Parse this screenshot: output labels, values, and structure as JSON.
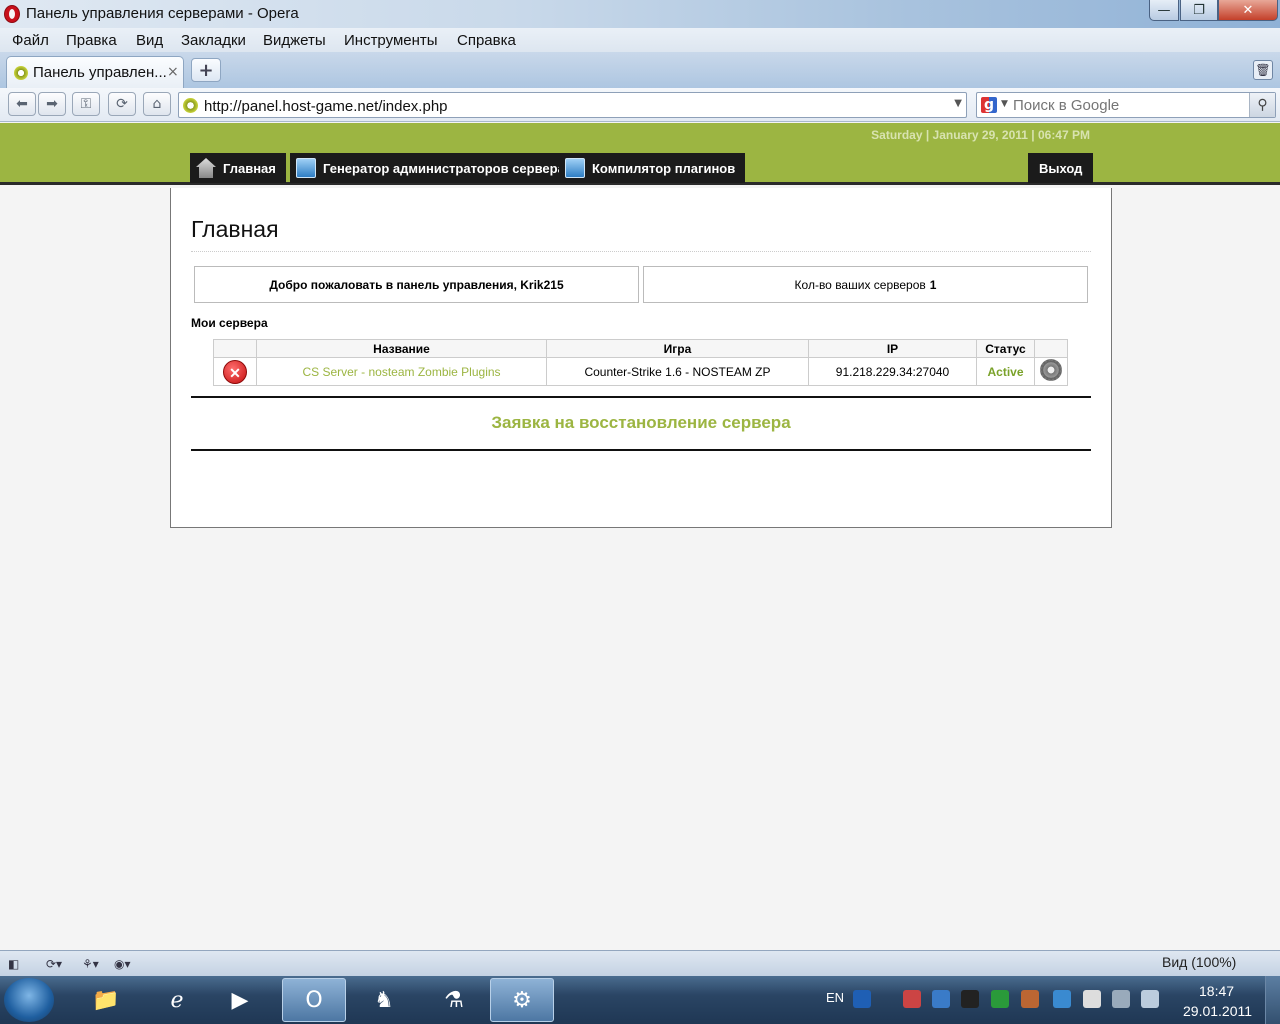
{
  "window": {
    "title": "Панель управления серверами - Opera",
    "minimize_glyph": "—",
    "maximize_glyph": "❐",
    "close_glyph": "✕"
  },
  "menu": [
    "Файл",
    "Правка",
    "Вид",
    "Закладки",
    "Виджеты",
    "Инструменты",
    "Справка"
  ],
  "tab": {
    "label": "Панель управлен...",
    "close_glyph": "×"
  },
  "new_tab_glyph": "+",
  "address": {
    "url": "http://panel.host-game.net/index.php",
    "dropdown_glyph": "▼"
  },
  "search": {
    "placeholder": "Поиск в Google",
    "engine_glyph": "g",
    "go_glyph": "⚲"
  },
  "site": {
    "date": "Saturday | January 29, 2011 | 06:47 PM",
    "nav": {
      "home": "Главная",
      "admin_generator": "Генератор администраторов сервера",
      "plugin_compiler": "Компилятор плагинов",
      "logout": "Выход"
    },
    "page_title": "Главная",
    "welcome": "Добро пожаловать в панель управления, Krik215",
    "servers_count_label": "Кол-во ваших серверов",
    "servers_count": "1",
    "my_servers_heading": "Мои сервера",
    "table": {
      "headers": [
        "Название",
        "Игра",
        "IP",
        "Статус"
      ],
      "rows": [
        {
          "name": "CS Server - nosteam Zombie Plugins",
          "game": "Counter-Strike 1.6 - NOSTEAM ZP",
          "ip": "91.218.229.34:27040",
          "status": "Active"
        }
      ]
    },
    "restore_link": "Заявка на восстановление сервера"
  },
  "statusbar": {
    "zoom": "Вид (100%)"
  },
  "taskbar": {
    "lang": "EN",
    "time": "18:47",
    "date": "29.01.2011"
  },
  "colors": {
    "brand_green": "#9cb542",
    "status_active": "#7aa22a",
    "nav_dark": "#1b1b1b"
  }
}
